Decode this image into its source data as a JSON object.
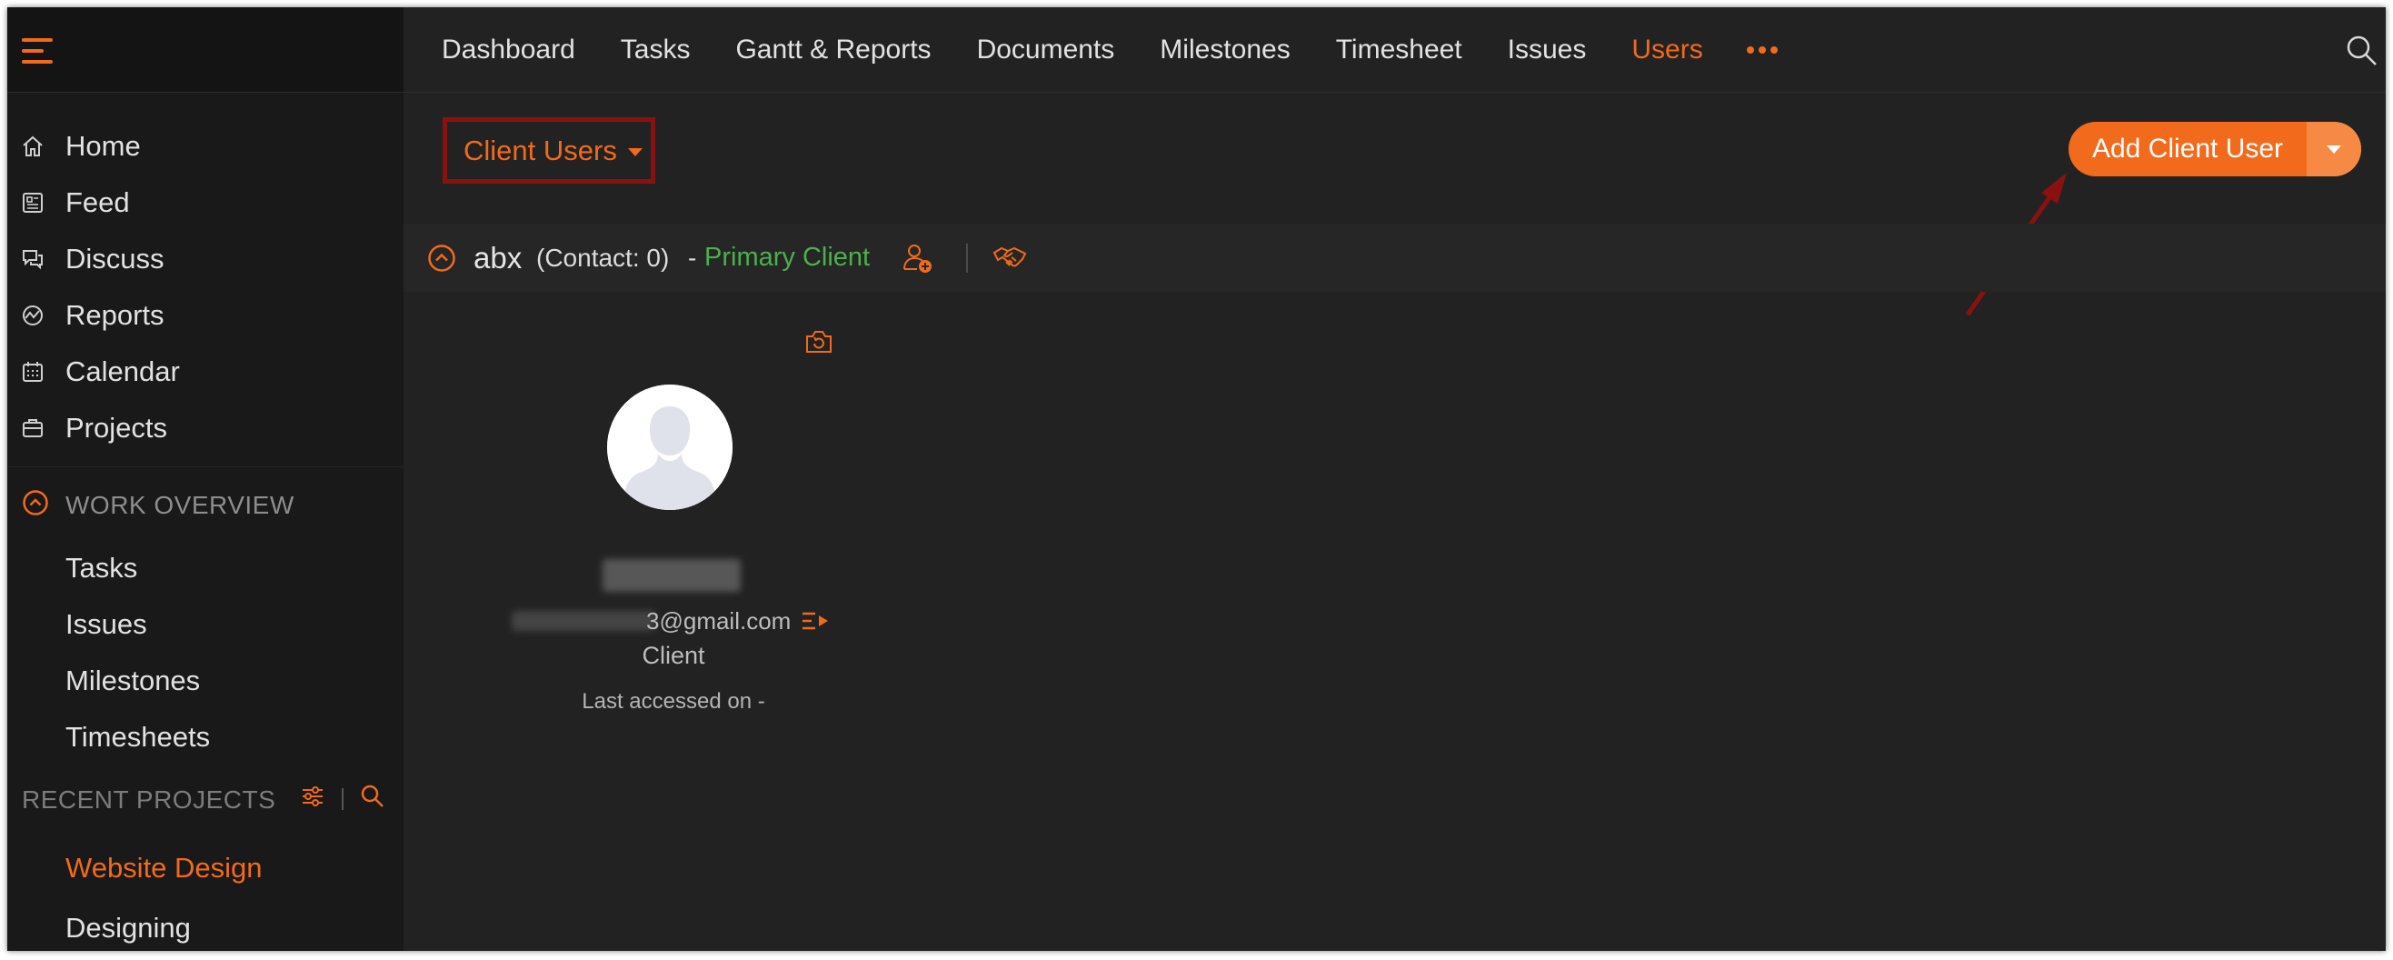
{
  "colors": {
    "accent": "#f26a1b",
    "primary_client": "#4cb04c",
    "highlight_box": "#8b1111"
  },
  "topnav": {
    "tabs": [
      {
        "label": "Dashboard"
      },
      {
        "label": "Tasks"
      },
      {
        "label": "Gantt & Reports"
      },
      {
        "label": "Documents"
      },
      {
        "label": "Milestones"
      },
      {
        "label": "Timesheet"
      },
      {
        "label": "Issues"
      },
      {
        "label": "Users",
        "active": true
      }
    ],
    "more_icon": "more-dots-icon",
    "search_icon": "search-icon"
  },
  "sidebar": {
    "nav": [
      {
        "label": "Home",
        "icon": "home-icon"
      },
      {
        "label": "Feed",
        "icon": "feed-icon"
      },
      {
        "label": "Discuss",
        "icon": "discuss-icon"
      },
      {
        "label": "Reports",
        "icon": "reports-icon"
      },
      {
        "label": "Calendar",
        "icon": "calendar-icon"
      },
      {
        "label": "Projects",
        "icon": "projects-icon"
      }
    ],
    "work_overview": {
      "title": "WORK OVERVIEW",
      "items": [
        "Tasks",
        "Issues",
        "Milestones",
        "Timesheets"
      ]
    },
    "recent_projects": {
      "title": "RECENT PROJECTS",
      "items": [
        {
          "label": "Website Design",
          "active": true
        },
        {
          "label": "Designing"
        }
      ]
    }
  },
  "toolbar": {
    "view_selector": "Client Users",
    "add_button": "Add Client User"
  },
  "client_group": {
    "name": "abx",
    "contact": "(Contact: 0)",
    "dash": "-",
    "type": "Primary Client"
  },
  "user_card": {
    "email_visible": "3@gmail.com",
    "role": "Client",
    "last_accessed": "Last accessed on -"
  }
}
